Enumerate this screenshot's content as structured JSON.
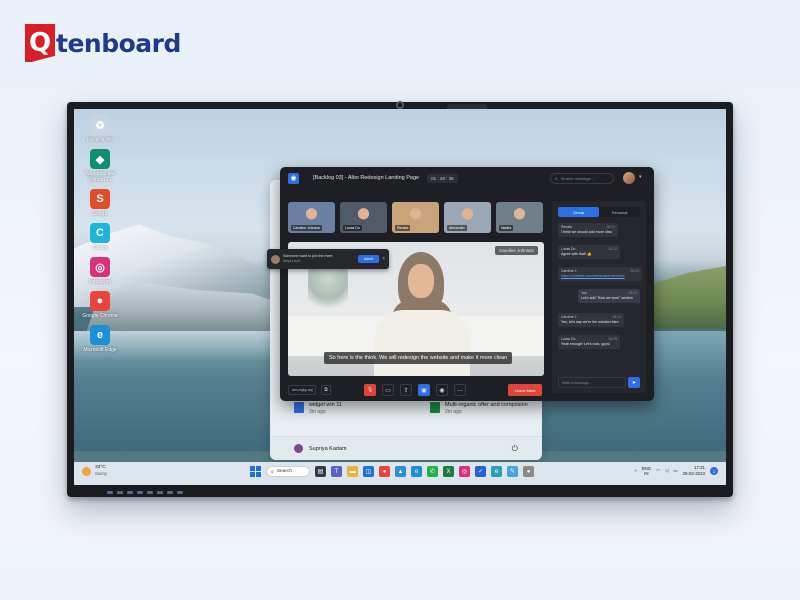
{
  "brand": {
    "mark": "Q",
    "name": "tenboard"
  },
  "desktop": {
    "icons": [
      {
        "icon": "recycle-bin-icon",
        "label": "Recycle Bin",
        "glyph": "♻",
        "color": "#c9d5e0"
      },
      {
        "icon": "wondershare-icon",
        "label": "Wondershare Filmora 11",
        "glyph": "◆",
        "color": "#0e8f6f"
      },
      {
        "icon": "snagit-icon",
        "label": "SnagIt",
        "glyph": "S",
        "color": "#e24d28"
      },
      {
        "icon": "canva-icon",
        "label": "Canva",
        "glyph": "C",
        "color": "#1fb5d8"
      },
      {
        "icon": "instagram-icon",
        "label": "Instagram",
        "glyph": "◎",
        "color": "#d8327a"
      },
      {
        "icon": "chrome-icon",
        "label": "Google Chrome",
        "glyph": "●",
        "color": "#e8453c"
      },
      {
        "icon": "edge-icon",
        "label": "Microsoft Edge",
        "glyph": "e",
        "color": "#1a8fd8"
      }
    ]
  },
  "start_menu": {
    "recommended": [
      {
        "title": "widget win 11",
        "time": "3m ago",
        "color": "#2d6fe6"
      },
      {
        "title": "Multi-organic offer and comprision",
        "time": "2m ago",
        "color": "#1d8a45"
      }
    ],
    "user": "Supriya Kadam",
    "power_icon": "⏻"
  },
  "meeting": {
    "logo": "◉",
    "title": "[Backlog 03] - Albo Redesign Landing Page",
    "timer": "01 : 28 : 35",
    "search_placeholder": "Search message...",
    "participants": [
      {
        "name": "Caroline Johnson",
        "bg": "#6b7fa0"
      },
      {
        "name": "Lucas Do",
        "bg": "#4f5b66"
      },
      {
        "name": "Renata",
        "bg": "#c9a37a"
      },
      {
        "name": "Alexander",
        "bg": "#9aa8b6"
      },
      {
        "name": "Nadira",
        "bg": "#6f7f8a"
      }
    ],
    "speaker_name": "Caroline Johnson",
    "caption": "So here is the think. We will redesign the website and make it more clean",
    "join_request": {
      "text": "Someone want to join the meet",
      "who": "Anya Leclr",
      "admit": "Admit",
      "close": "×"
    },
    "controls": {
      "meeting_code": "anv-eqky-naj",
      "copy_icon": "⧉",
      "mic_icon": "🎙",
      "camera_icon": "▭",
      "share_icon": "⇧",
      "present_icon": "▣",
      "record_icon": "◉",
      "more_icon": "…",
      "leave": "Leave Meet"
    },
    "chat": {
      "tabs": [
        "Group",
        "Personal"
      ],
      "messages": [
        {
          "name": "Renata",
          "time": "06:21",
          "text": "I think we should add more idea",
          "mine": false,
          "link": false
        },
        {
          "name": "Lucas Do",
          "time": "06:22",
          "text": "Agree with that! 👍",
          "mine": false,
          "link": false
        },
        {
          "name": "Caroline J.",
          "time": "06:23",
          "text": "https://dribbble.com/stelianlab/members",
          "mine": false,
          "link": true
        },
        {
          "name": "You",
          "time": "06:23",
          "text": "Let's add \"How we work\" section",
          "mine": true,
          "link": false
        },
        {
          "name": "Caroline J.",
          "time": "06:24",
          "text": "Yes, let's say we're the solution then",
          "mine": false,
          "link": false
        },
        {
          "name": "Lucas Do",
          "time": "06:25",
          "text": "Yeah enough! Let's rock, guys!",
          "mine": false,
          "link": false
        }
      ],
      "input_placeholder": "Write a message...",
      "send_icon": "➤"
    }
  },
  "taskbar": {
    "weather_temp": "33°C",
    "weather_desc": "Sunny",
    "search_label": "Search",
    "search_icon": "⌕",
    "apps": [
      {
        "icon": "task-view-icon",
        "glyph": "▤",
        "color": "#333a44"
      },
      {
        "icon": "teams-icon",
        "glyph": "T",
        "color": "#5b5fc7"
      },
      {
        "icon": "file-explorer-icon",
        "glyph": "▬",
        "color": "#e8b43c"
      },
      {
        "icon": "store-icon",
        "glyph": "◫",
        "color": "#1d72d8"
      },
      {
        "icon": "chrome-icon",
        "glyph": "●",
        "color": "#e8453c"
      },
      {
        "icon": "photos-icon",
        "glyph": "▲",
        "color": "#2a8fd8"
      },
      {
        "icon": "edge-icon",
        "glyph": "e",
        "color": "#1a8fd8"
      },
      {
        "icon": "whatsapp-icon",
        "glyph": "✆",
        "color": "#25b14a"
      },
      {
        "icon": "excel-icon",
        "glyph": "X",
        "color": "#1d7a44"
      },
      {
        "icon": "instagram-icon",
        "glyph": "◎",
        "color": "#d8327a"
      },
      {
        "icon": "todo-icon",
        "glyph": "✓",
        "color": "#2564cf"
      },
      {
        "icon": "edge-dev-icon",
        "glyph": "e",
        "color": "#2aa0b8"
      },
      {
        "icon": "paint-icon",
        "glyph": "✎",
        "color": "#4aa3df"
      },
      {
        "icon": "avatar-icon",
        "glyph": "●",
        "color": "#8a8a8a"
      }
    ],
    "tray_chevron": "^",
    "lang_top": "ENG",
    "lang_bottom": "IN",
    "time": "17:21",
    "date": "25-02-2023",
    "notification": "1"
  }
}
